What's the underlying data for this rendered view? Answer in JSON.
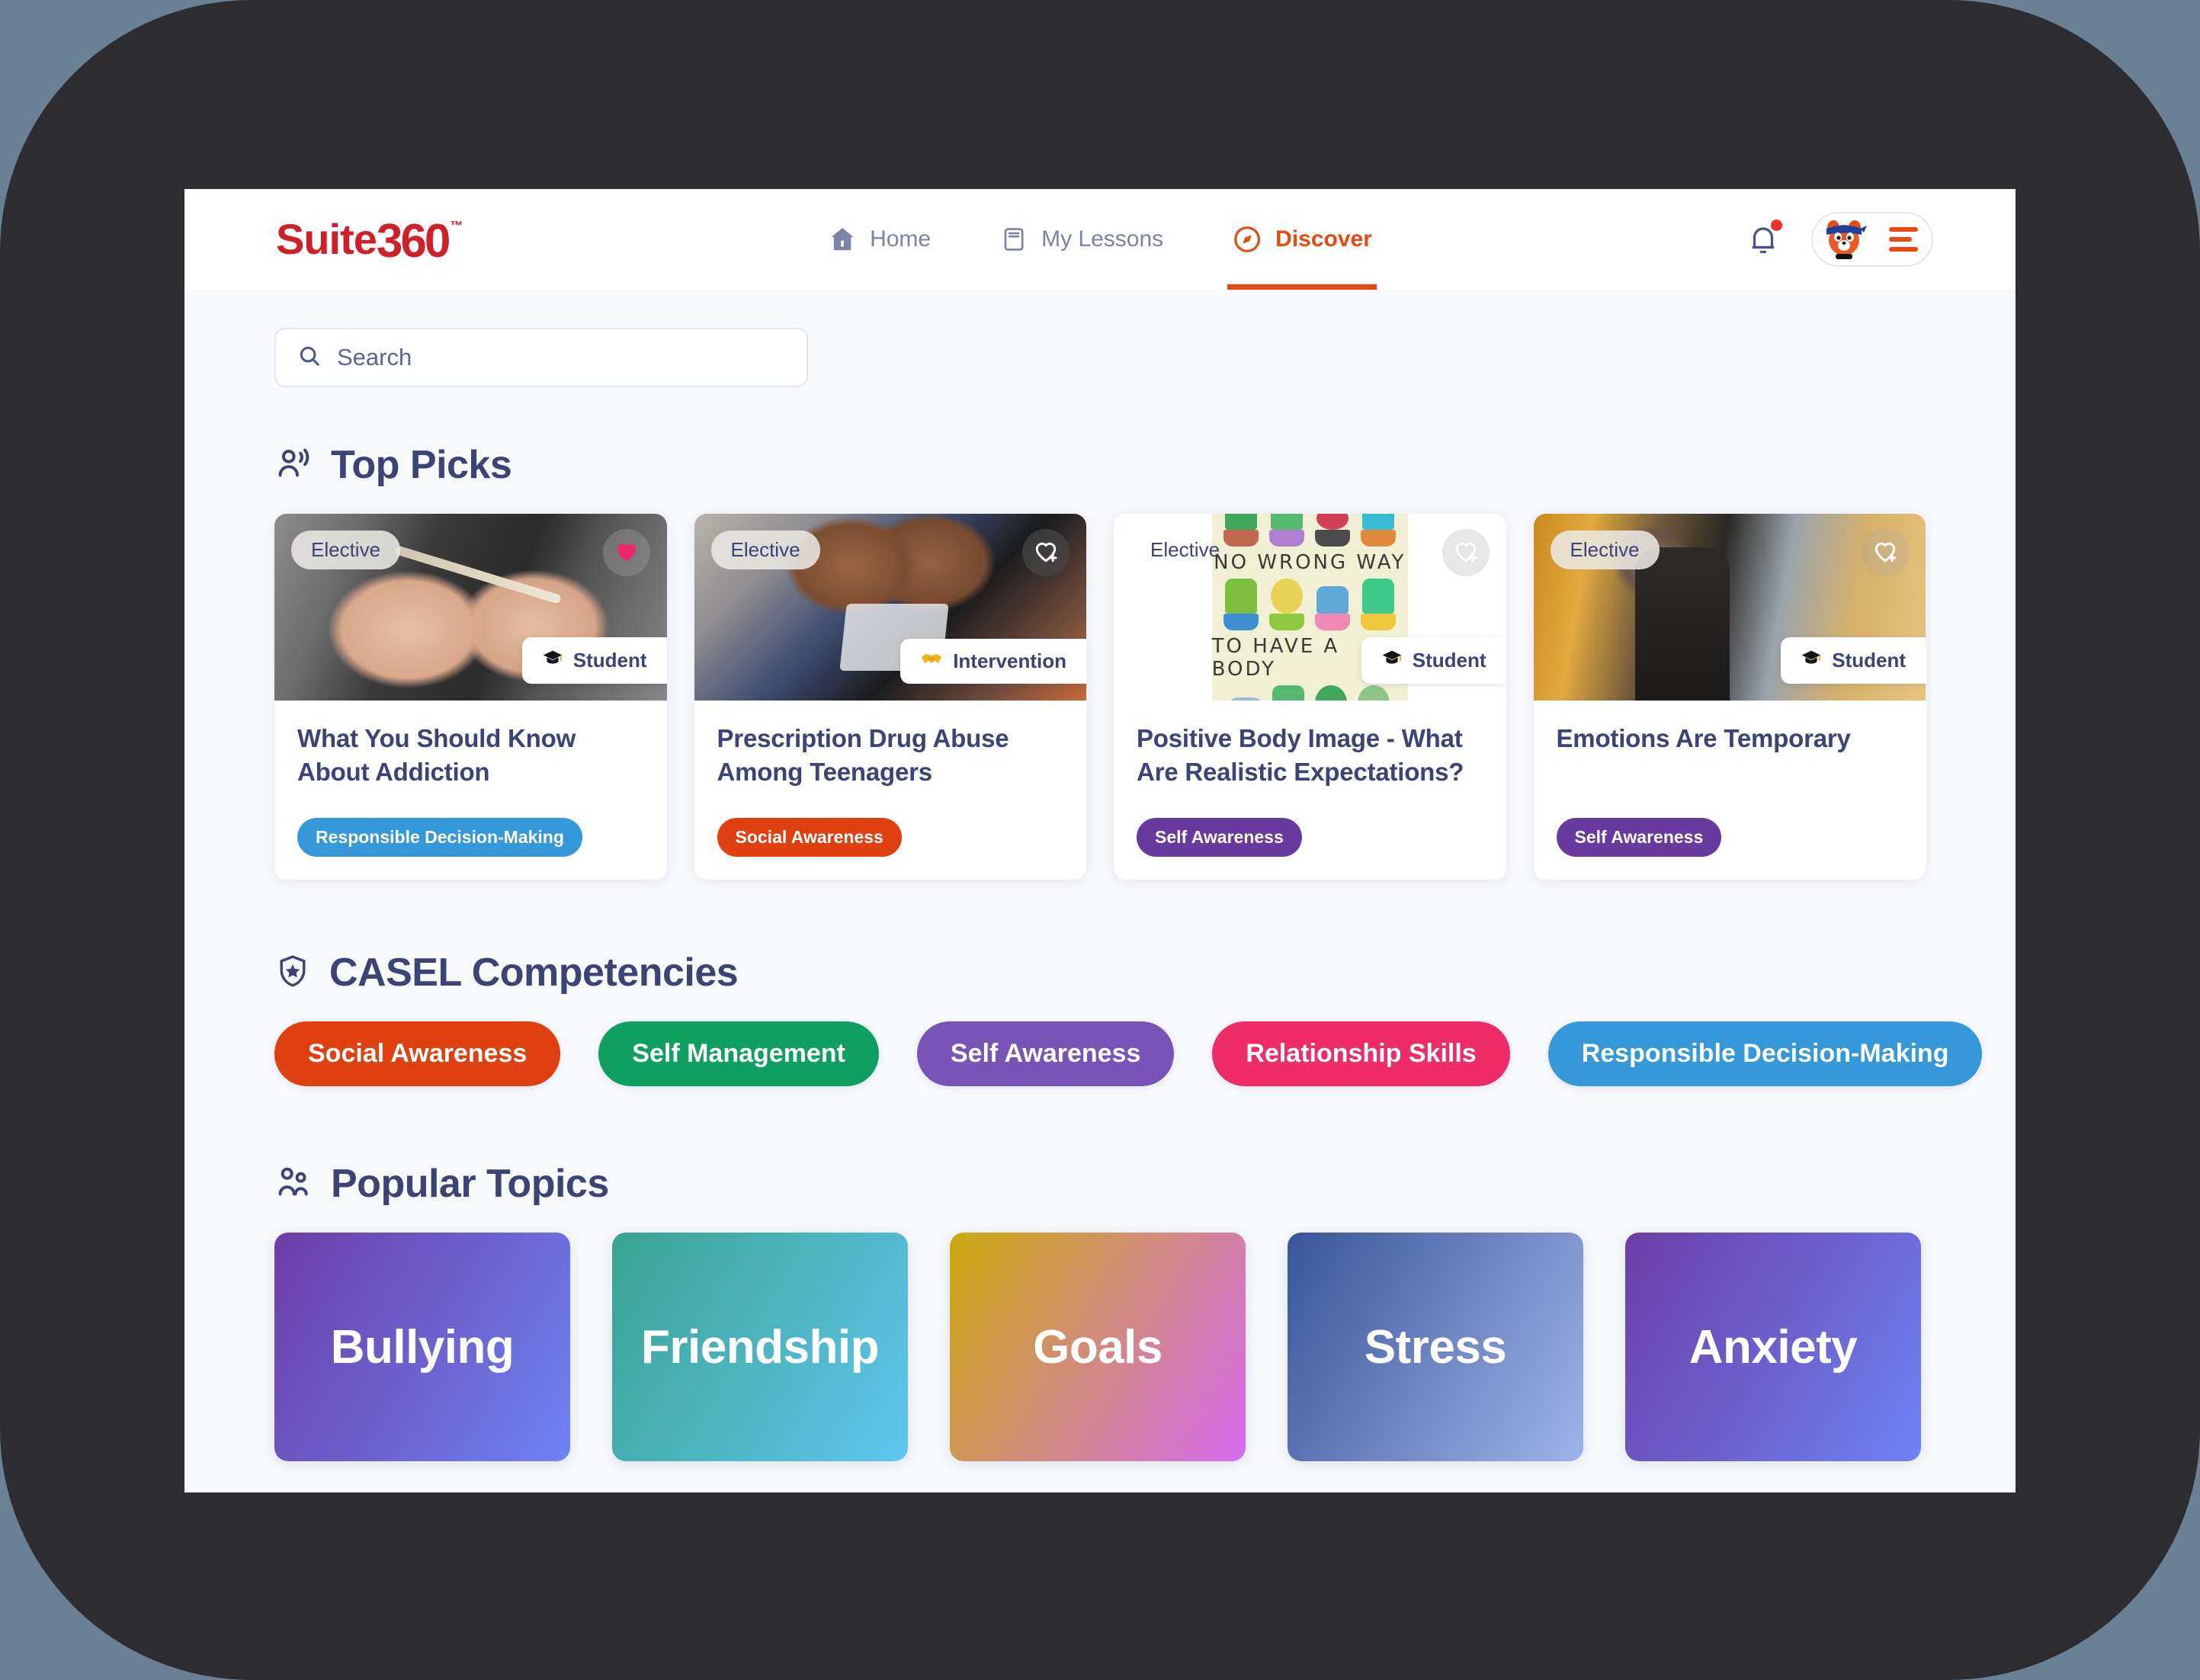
{
  "brand": {
    "name_part1": "Suite",
    "name_part2": "360",
    "trademark": "™",
    "color": "#d02027"
  },
  "nav": {
    "items": [
      {
        "label": "Home",
        "icon": "home-icon",
        "active": false
      },
      {
        "label": "My Lessons",
        "icon": "book-icon",
        "active": false
      },
      {
        "label": "Discover",
        "icon": "compass-icon",
        "active": true
      }
    ],
    "active_color": "#ea4a11",
    "inactive_color": "#7b84a3"
  },
  "header_actions": {
    "bell": "notification-bell-icon",
    "has_unread": true,
    "avatar": "fox-mascot-avatar",
    "menu": "hamburger-menu-icon"
  },
  "search": {
    "placeholder": "Search",
    "value": "",
    "icon": "search-icon"
  },
  "sections": {
    "top_picks": {
      "title": "Top Picks",
      "icon": "person-broadcast-icon"
    },
    "casel": {
      "title": "CASEL Competencies",
      "icon": "shield-star-icon"
    },
    "popular_topics": {
      "title": "Popular Topics",
      "icon": "two-people-icon"
    }
  },
  "top_picks": [
    {
      "elective_label": "Elective",
      "favorited": true,
      "favorite_icon": "heart-filled-icon",
      "meta_label": "Student",
      "meta_icon": "graduation-cap-icon",
      "title": "What You Should Know About Addiction",
      "tag": "Responsible Decision-Making",
      "tag_color": "#3498db"
    },
    {
      "elective_label": "Elective",
      "favorited": false,
      "favorite_icon": "heart-plus-icon",
      "meta_label": "Intervention",
      "meta_icon": "handshake-icon",
      "title": "Prescription Drug Abuse Among Teenagers",
      "tag": "Social Awareness",
      "tag_color": "#e0400f"
    },
    {
      "elective_label": "Elective",
      "favorited": false,
      "favorite_icon": "heart-plus-icon",
      "meta_label": "Student",
      "meta_icon": "graduation-cap-icon",
      "title": "Positive Body Image - What Are Realistic Expectations?",
      "tag": "Self Awareness",
      "tag_color": "#673a9e",
      "image_text_line1": "NO WRONG WAY",
      "image_text_line2": "TO HAVE A BODY"
    },
    {
      "elective_label": "Elective",
      "favorited": false,
      "favorite_icon": "heart-plus-icon",
      "meta_label": "Student",
      "meta_icon": "graduation-cap-icon",
      "title": "Emotions Are Temporary",
      "tag": "Self Awareness",
      "tag_color": "#673a9e"
    }
  ],
  "casel_competencies": [
    {
      "label": "Social Awareness",
      "color": "#e0400f"
    },
    {
      "label": "Self Management",
      "color": "#0f9f60"
    },
    {
      "label": "Self Awareness",
      "color": "#7754b6"
    },
    {
      "label": "Relationship Skills",
      "color": "#ef2b68"
    },
    {
      "label": "Responsible Decision-Making",
      "color": "#3498db"
    }
  ],
  "popular_topics": [
    {
      "label": "Bullying",
      "gradient_from": "#6b3fa6",
      "gradient_to": "#6f82f5"
    },
    {
      "label": "Friendship",
      "gradient_from": "#3aa38f",
      "gradient_to": "#5ec6f0"
    },
    {
      "label": "Goals",
      "gradient_from": "#ccaa0c",
      "gradient_to": "#d66bf0"
    },
    {
      "label": "Stress",
      "gradient_from": "#3a5699",
      "gradient_to": "#9fb3e8"
    },
    {
      "label": "Anxiety",
      "gradient_from": "#6b3fa6",
      "gradient_to": "#6f82f5"
    }
  ]
}
